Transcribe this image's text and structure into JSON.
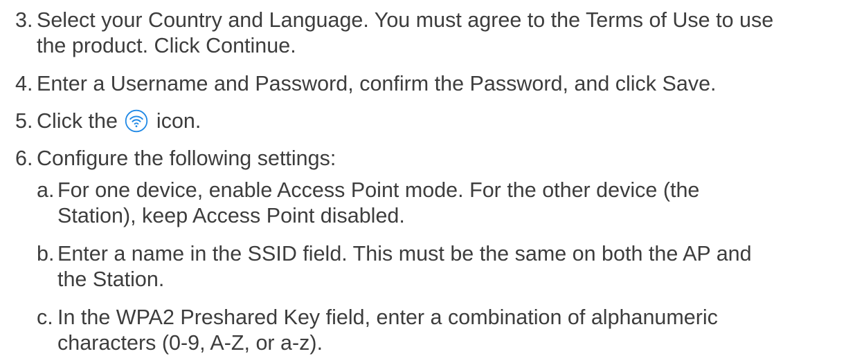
{
  "colors": {
    "text": "#3d3d3d",
    "icon_accent": "#1e88e5"
  },
  "steps": [
    {
      "number": "3.",
      "line1": "Select your Country and Language. You must agree to the Terms of Use to use",
      "line2": "the product. Click Continue."
    },
    {
      "number": "4.",
      "text": "Enter a Username and Password, confirm the Password, and click Save."
    },
    {
      "number": "5.",
      "before_icon": "Click the",
      "icon": "wifi-circle-icon",
      "after_icon": "icon."
    },
    {
      "number": "6.",
      "text": "Configure the following settings:",
      "substeps": [
        {
          "letter": "a.",
          "line1": "For one device, enable Access Point mode. For the other device (the",
          "line2": "Station), keep Access Point disabled."
        },
        {
          "letter": "b.",
          "line1": "Enter a name in the SSID field. This must be the same on both the AP and",
          "line2": "the Station."
        },
        {
          "letter": "c.",
          "line1": "In the WPA2 Preshared Key field, enter a combination of alphanumeric",
          "line2": "characters (0-9, A-Z, or a-z)."
        }
      ]
    }
  ]
}
